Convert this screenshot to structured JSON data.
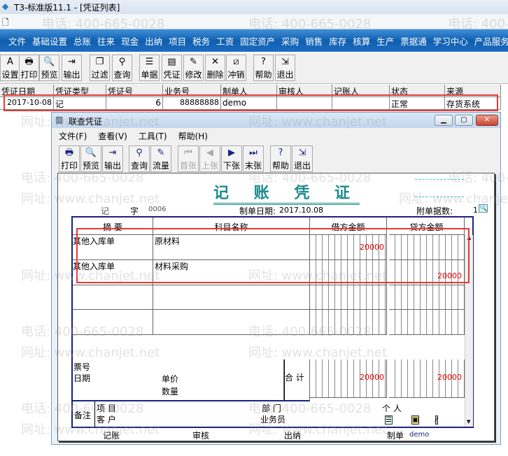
{
  "app_title": "T3-标准版11.1 - [凭证列表]",
  "menu": [
    "文件",
    "基础设置",
    "总账",
    "往来",
    "现金",
    "出纳",
    "项目",
    "税务",
    "工资",
    "固定资产",
    "采购",
    "销售",
    "库存",
    "核算",
    "生产",
    "票据通",
    "学习中心",
    "产品服务"
  ],
  "toolbar": [
    {
      "label": "设置",
      "icon": "A"
    },
    {
      "label": "打印",
      "icon": "🖶"
    },
    {
      "label": "预览",
      "icon": "🔍"
    },
    {
      "label": "输出",
      "icon": "⇥"
    },
    {
      "label": "过滤",
      "icon": "❐"
    },
    {
      "label": "查询",
      "icon": "⚲"
    },
    {
      "label": "单据",
      "icon": "☰"
    },
    {
      "label": "凭证",
      "icon": "▤"
    },
    {
      "label": "修改",
      "icon": "✎"
    },
    {
      "label": "删除",
      "icon": "✕"
    },
    {
      "label": "冲销",
      "icon": "⧄"
    },
    {
      "label": "帮助",
      "icon": "?"
    },
    {
      "label": "退出",
      "icon": "⇲"
    }
  ],
  "grid": {
    "headers": [
      "凭证日期",
      "凭证类型",
      "凭证号",
      "业务号",
      "制单人",
      "审核人",
      "记账人",
      "状态",
      "来源"
    ],
    "rows": [
      [
        "2017-10-08",
        "记",
        "6",
        "88888888",
        "demo",
        "",
        "",
        "正常",
        "存货系统"
      ]
    ]
  },
  "dialog": {
    "title": "联查凭证",
    "menu": [
      "文件(F)",
      "查看(V)",
      "工具(T)",
      "帮助(H)"
    ],
    "toolbar": [
      {
        "label": "打印",
        "icon": "🖶",
        "enabled": true
      },
      {
        "label": "预览",
        "icon": "🔍",
        "enabled": true
      },
      {
        "label": "输出",
        "icon": "⇥",
        "enabled": true
      },
      {
        "label": "查询",
        "icon": "⚲",
        "enabled": true
      },
      {
        "label": "流量",
        "icon": "✎",
        "enabled": true
      },
      {
        "label": "首张",
        "icon": "⏮",
        "enabled": false
      },
      {
        "label": "上张",
        "icon": "◀",
        "enabled": false
      },
      {
        "label": "下张",
        "icon": "▶",
        "enabled": true
      },
      {
        "label": "末张",
        "icon": "⏭",
        "enabled": true
      },
      {
        "label": "帮助",
        "icon": "?",
        "enabled": true
      },
      {
        "label": "退出",
        "icon": "⇲",
        "enabled": true
      }
    ],
    "voucher": {
      "title": "记 账 凭 证",
      "type": "记",
      "zi": "字",
      "number": "0006",
      "date_label": "制单日期:",
      "date": "2017.10.08",
      "attach_label": "附单据数:",
      "attach_count": "1",
      "headers": [
        "摘 要",
        "科目名称",
        "借方金额",
        "贷方金额"
      ],
      "entries": [
        {
          "summary": "其他入库单",
          "account": "原材料",
          "debit": "20000",
          "credit": ""
        },
        {
          "summary": "其他入库单",
          "account": "材料采购",
          "debit": "",
          "credit": "20000"
        }
      ],
      "footer": {
        "ticket": "票号",
        "date": "日期",
        "price": "单价",
        "qty": "数量",
        "total_label": "合 计",
        "total_debit": "20000",
        "total_credit": "20000"
      },
      "remarks": {
        "label": "备注",
        "project": "项 目",
        "customer": "客 户",
        "dept": "部 门",
        "salesman": "业务员",
        "person": "个 人"
      },
      "signatures": {
        "post": "记账",
        "audit": "审核",
        "cashier": "出纳",
        "maker_label": "制单",
        "maker": "demo"
      }
    }
  },
  "watermark": {
    "phone": "电话: 400-665-0028",
    "site": "网址: www.chanjet.net"
  }
}
